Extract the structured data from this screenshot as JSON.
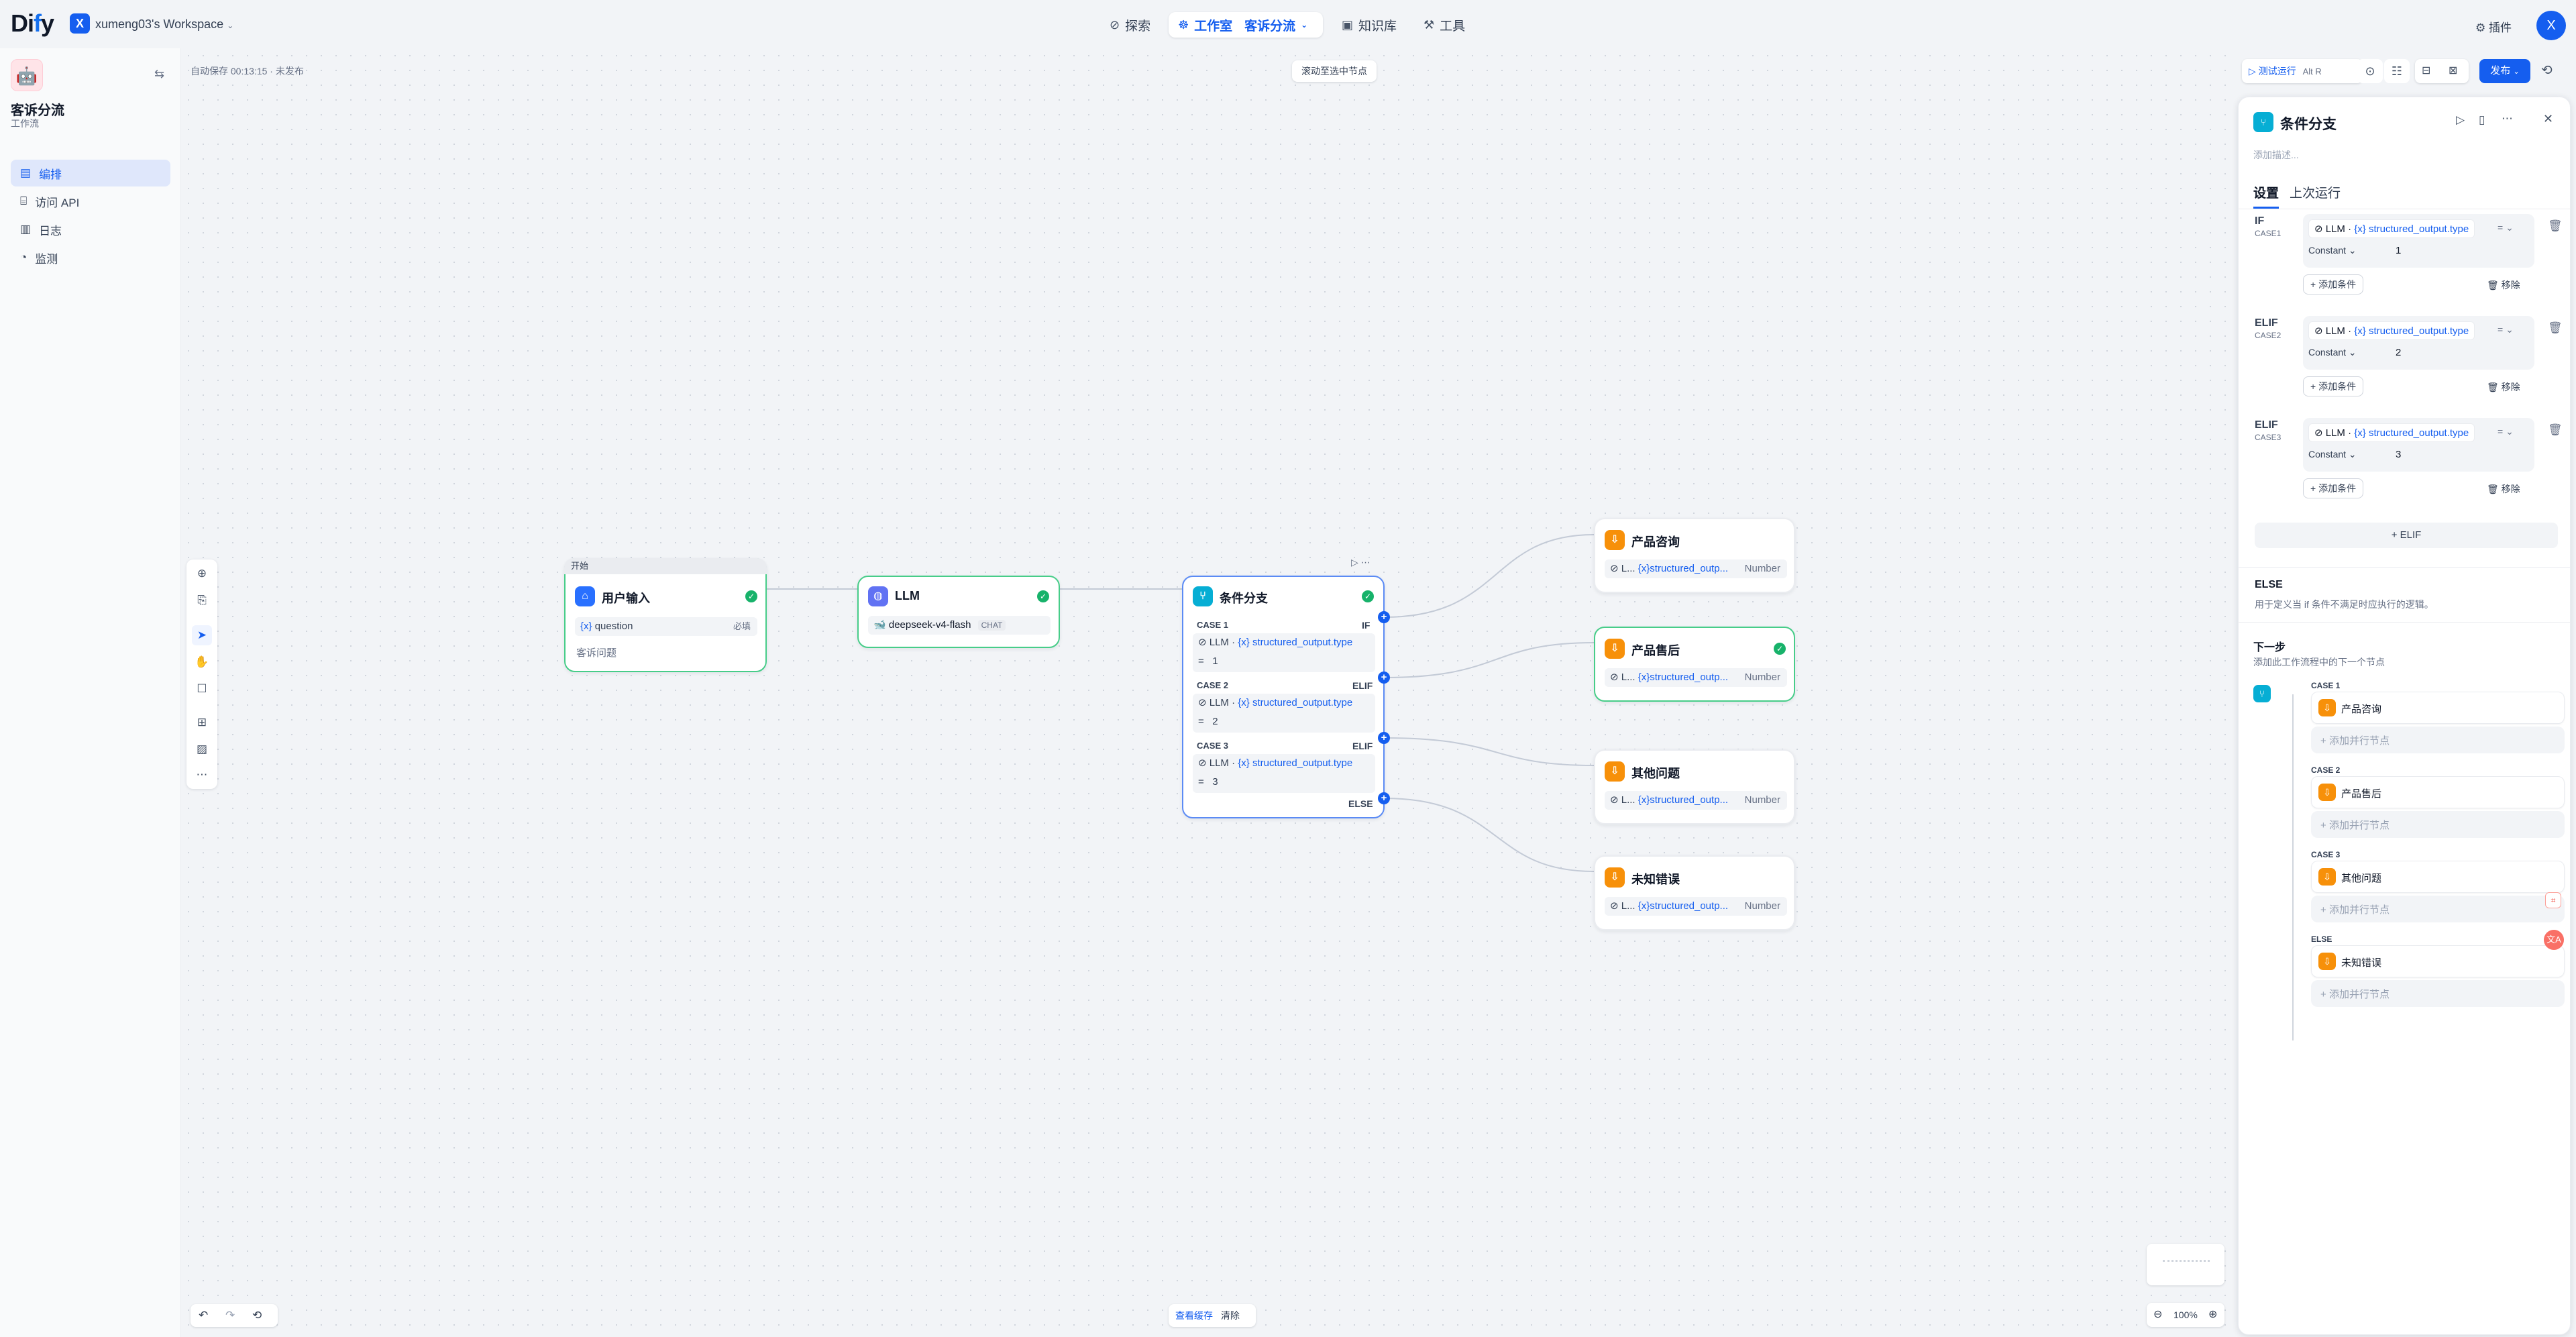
{
  "topbar": {
    "logo": "Dify",
    "workspace_initial": "X",
    "workspace_name": "xumeng03's Workspace",
    "nav": [
      {
        "label": "探索",
        "icon": "compass-icon"
      },
      {
        "label": "工作室",
        "icon": "studio-icon"
      },
      {
        "label": "客诉分流",
        "icon": "chevron-down-icon"
      },
      {
        "label": "知识库",
        "icon": "book-icon"
      },
      {
        "label": "工具",
        "icon": "tool-icon"
      }
    ],
    "plugins": "插件",
    "avatar_initial": "X"
  },
  "sidebar": {
    "app_name": "客诉分流",
    "app_type": "工作流",
    "items": [
      {
        "label": "编排",
        "icon": "layout-icon",
        "active": true
      },
      {
        "label": "访问 API",
        "icon": "api-icon"
      },
      {
        "label": "日志",
        "icon": "log-icon"
      },
      {
        "label": "监测",
        "icon": "monitor-icon"
      }
    ]
  },
  "canvas": {
    "autosave": "自动保存 00:13:15 · 未发布",
    "scroll_to_selected": "滚动至选中节点",
    "view_cache": "查看缓存",
    "clear": "清除",
    "zoom": "100%",
    "toolbar_icons": [
      "add-node-icon",
      "note-icon",
      "pointer-icon",
      "hand-icon",
      "comment-icon",
      "organize-icon",
      "export-image-icon",
      "more-icon"
    ]
  },
  "nodes": {
    "start": {
      "badge": "开始",
      "title": "用户输入",
      "var_prefix": "{x}",
      "var_name": "question",
      "required": "必填",
      "desc": "客诉问题"
    },
    "llm": {
      "title": "LLM",
      "model": "deepseek-v4-flash",
      "mode": "CHAT"
    },
    "ifelse": {
      "title": "条件分支",
      "cases": [
        {
          "case": "CASE 1",
          "type": "IF",
          "var": "structured_output.type",
          "op": "=",
          "value": "1"
        },
        {
          "case": "CASE 2",
          "type": "ELIF",
          "var": "structured_output.type",
          "op": "=",
          "value": "2"
        },
        {
          "case": "CASE 3",
          "type": "ELIF",
          "var": "structured_output.type",
          "op": "=",
          "value": "3"
        }
      ],
      "else_label": "ELSE",
      "var_node": "LLM",
      "var_prefix": "{x}"
    },
    "outputs": [
      {
        "title": "产品咨询",
        "var_node": "L...",
        "var": "{x}structured_outp...",
        "type": "Number"
      },
      {
        "title": "产品售后",
        "var_node": "L...",
        "var": "{x}structured_outp...",
        "type": "Number"
      },
      {
        "title": "其他问题",
        "var_node": "L...",
        "var": "{x}structured_outp...",
        "type": "Number"
      },
      {
        "title": "未知错误",
        "var_node": "L...",
        "var": "{x}structured_outp...",
        "type": "Number"
      }
    ]
  },
  "header_actions": {
    "test_run": "测试运行",
    "shortcut": "Alt R",
    "publish": "发布"
  },
  "panel": {
    "title": "条件分支",
    "desc_placeholder": "添加描述...",
    "tabs": [
      "设置",
      "上次运行"
    ],
    "cases": [
      {
        "label": "IF",
        "sub": "CASE1",
        "var_node": "LLM",
        "var": "{x} structured_output.type",
        "op": "=",
        "const": "Constant",
        "value": "1"
      },
      {
        "label": "ELIF",
        "sub": "CASE2",
        "var_node": "LLM",
        "var": "{x} structured_output.type",
        "op": "=",
        "const": "Constant",
        "value": "2"
      },
      {
        "label": "ELIF",
        "sub": "CASE3",
        "var_node": "LLM",
        "var": "{x} structured_output.type",
        "op": "=",
        "const": "Constant",
        "value": "3"
      }
    ],
    "add_condition": "添加条件",
    "remove": "移除",
    "add_elif": "+ ELIF",
    "else_title": "ELSE",
    "else_desc": "用于定义当 if 条件不满足时应执行的逻辑。",
    "next_title": "下一步",
    "next_desc": "添加此工作流程中的下一个节点",
    "next_branches": [
      {
        "case": "CASE 1",
        "node": "产品咨询"
      },
      {
        "case": "CASE 2",
        "node": "产品售后"
      },
      {
        "case": "CASE 3",
        "node": "其他问题"
      },
      {
        "case": "ELSE",
        "node": "未知错误"
      }
    ],
    "add_parallel": "添加并行节点"
  }
}
